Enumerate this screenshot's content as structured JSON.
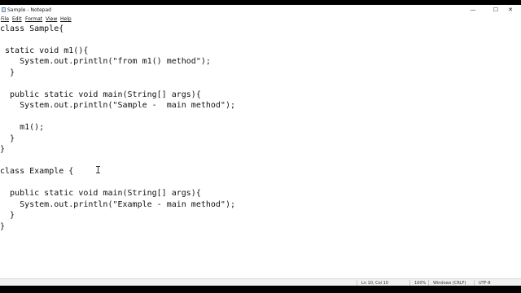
{
  "window": {
    "title": "Sample - Notepad",
    "controls": {
      "minimize": "—",
      "maximize": "☐",
      "close": "✕"
    }
  },
  "menu": [
    "File",
    "Edit",
    "Format",
    "View",
    "Help"
  ],
  "code": [
    "class Sample{",
    "",
    " static void m1(){",
    "    System.out.println(\"from m1() method\");",
    "  }",
    "",
    "  public static void main(String[] args){",
    "    System.out.println(\"Sample -  main method\");",
    "",
    "    m1();",
    "  }",
    "}",
    "",
    "class Example {",
    "",
    "  public static void main(String[] args){",
    "    System.out.println(\"Example - main method\");",
    "  }",
    "}"
  ],
  "status": {
    "position": "Ln 10, Col 10",
    "zoom": "100%",
    "line_endings": "Windows (CRLF)",
    "encoding": "UTF-8"
  }
}
